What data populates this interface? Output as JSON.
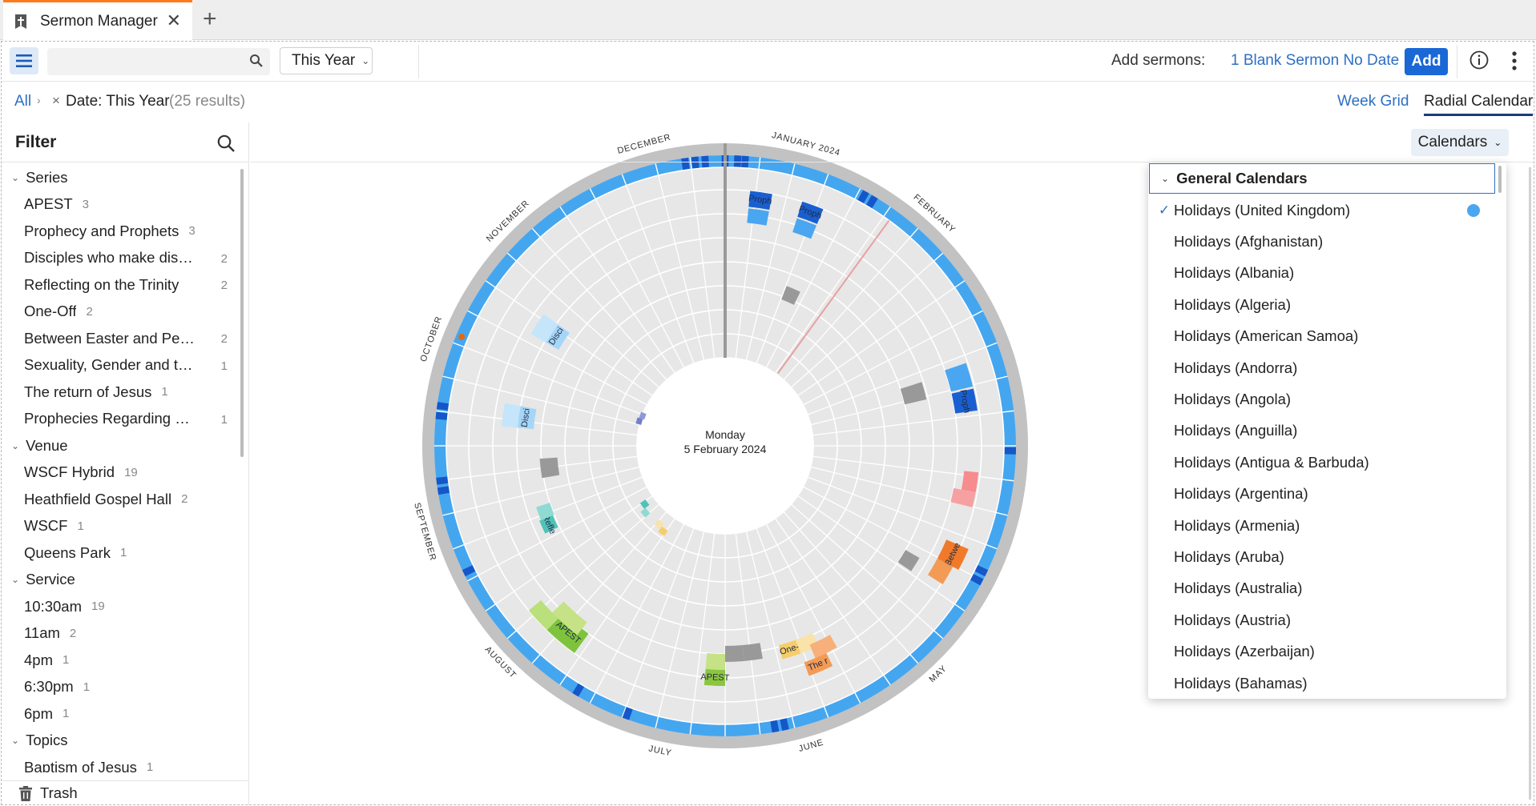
{
  "tab": {
    "title": "Sermon Manager",
    "close": "✕",
    "new_tab": "+"
  },
  "toolbar": {
    "search_placeholder": "",
    "date_range": "This Year",
    "add_label": "Add sermons:",
    "add_link": "1 Blank Sermon No Date",
    "add_button": "Add"
  },
  "breadcrumb": {
    "all": "All",
    "sep": "›",
    "remove": "×",
    "filter": "Date: This Year",
    "count": "(25 results)"
  },
  "views": {
    "week_grid": "Week Grid",
    "radial_calendar": "Radial Calendar"
  },
  "sidebar": {
    "title": "Filter",
    "groups": [
      {
        "label": "Series",
        "items": [
          {
            "label": "APEST",
            "count": "3"
          },
          {
            "label": "Prophecy and Prophets",
            "count": "3"
          },
          {
            "label": "Disciples who make disciples",
            "count": "2"
          },
          {
            "label": "Reflecting on the Trinity",
            "count": "2"
          },
          {
            "label": "One-Off",
            "count": "2"
          },
          {
            "label": "Between Easter and Pentecost",
            "count": "2"
          },
          {
            "label": "Sexuality, Gender and the Bible",
            "count": "1"
          },
          {
            "label": "The return of Jesus",
            "count": "1"
          },
          {
            "label": "Prophecies Regarding Easter",
            "count": "1"
          }
        ]
      },
      {
        "label": "Venue",
        "items": [
          {
            "label": "WSCF Hybrid",
            "count": "19"
          },
          {
            "label": "Heathfield Gospel Hall",
            "count": "2"
          },
          {
            "label": "WSCF",
            "count": "1"
          },
          {
            "label": "Queens Park",
            "count": "1"
          }
        ]
      },
      {
        "label": "Service",
        "items": [
          {
            "label": "10:30am",
            "count": "19"
          },
          {
            "label": "11am",
            "count": "2"
          },
          {
            "label": "4pm",
            "count": "1"
          },
          {
            "label": "6:30pm",
            "count": "1"
          },
          {
            "label": "6pm",
            "count": "1"
          }
        ]
      },
      {
        "label": "Topics",
        "items": [
          {
            "label": "Baptism of Jesus",
            "count": "1"
          }
        ]
      }
    ],
    "trash": "Trash"
  },
  "calendars_button": "Calendars",
  "center": {
    "weekday": "Monday",
    "date": "5 February 2024"
  },
  "months": [
    "JANUARY 2024",
    "FEBRUARY",
    "MAY",
    "JUNE",
    "JULY",
    "AUGUST",
    "SEPTEMBER",
    "OCTOBER",
    "NOVEMBER",
    "DECEMBER"
  ],
  "event_labels": {
    "prophecy": "Proph",
    "disciples": "Disci",
    "reflecting": "Refle",
    "apest": "APEST",
    "one_off": "One-",
    "the_return": "The r",
    "between": "Betwe"
  },
  "dropdown": {
    "header": "General Calendars",
    "items": [
      {
        "label": "Holidays (United Kingdom)",
        "checked": true,
        "color": "#4aa6f0"
      },
      {
        "label": "Holidays (Afghanistan)"
      },
      {
        "label": "Holidays (Albania)"
      },
      {
        "label": "Holidays (Algeria)"
      },
      {
        "label": "Holidays (American Samoa)"
      },
      {
        "label": "Holidays (Andorra)"
      },
      {
        "label": "Holidays (Angola)"
      },
      {
        "label": "Holidays (Anguilla)"
      },
      {
        "label": "Holidays (Antigua & Barbuda)"
      },
      {
        "label": "Holidays (Argentina)"
      },
      {
        "label": "Holidays (Armenia)"
      },
      {
        "label": "Holidays (Aruba)"
      },
      {
        "label": "Holidays (Australia)"
      },
      {
        "label": "Holidays (Austria)"
      },
      {
        "label": "Holidays (Azerbaijan)"
      },
      {
        "label": "Holidays (Bahamas)"
      }
    ]
  },
  "colors": {
    "accent": "#1a67d6",
    "link": "#2d6fc4",
    "tab_accent": "#ff7a1a",
    "ring_blue": "#45a6f0",
    "ring_grey": "#c2c2c2",
    "ring_bg": "#e7e7e7"
  }
}
